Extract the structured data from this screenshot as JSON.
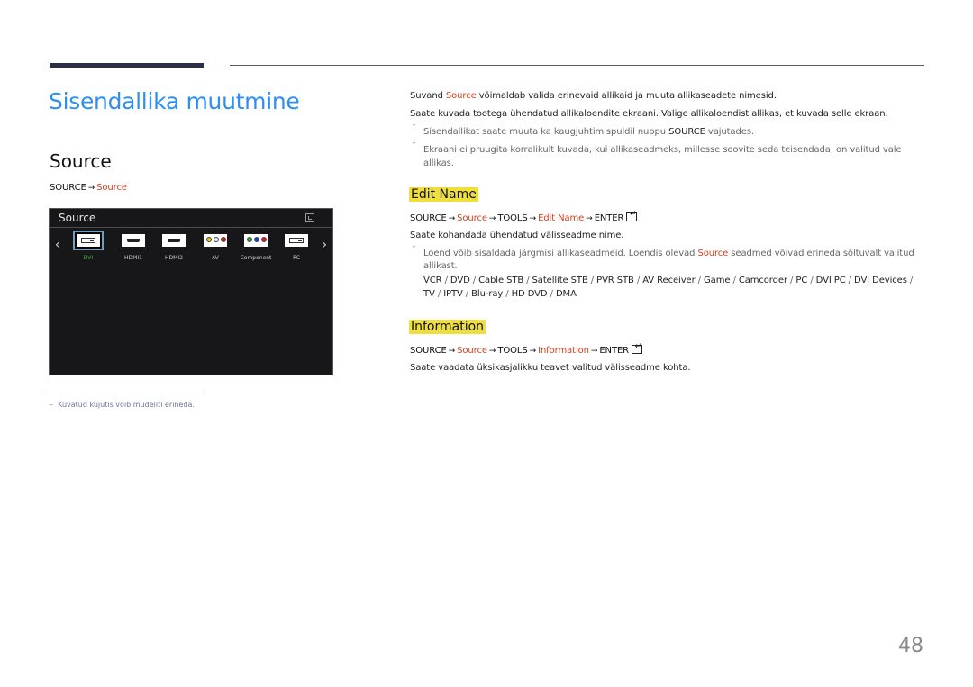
{
  "page": {
    "title": "Sisendallika muutmine",
    "section_title": "Source",
    "path": {
      "root": "SOURCE",
      "arrow": "→",
      "target": "Source"
    },
    "page_number": "48",
    "footnote": "Kuvatud kujutis võib mudeliti erineda."
  },
  "tv_screen": {
    "title": "Source",
    "sources": [
      {
        "label": "DVI",
        "icon": "dvi-port-icon",
        "selected": true
      },
      {
        "label": "HDMI1",
        "icon": "hdmi-port-icon"
      },
      {
        "label": "HDMI2",
        "icon": "hdmi-port-icon"
      },
      {
        "label": "AV",
        "icon": "av-port-icon"
      },
      {
        "label": "Component",
        "icon": "component-port-icon"
      },
      {
        "label": "PC",
        "icon": "pc-port-icon"
      }
    ],
    "colors": {
      "selected_label": "#4fb53a",
      "av": [
        "#e7c318",
        "#f0f0f0",
        "#d42020"
      ],
      "component": [
        "#22a83a",
        "#2040d0",
        "#d42020"
      ]
    }
  },
  "right": {
    "intro1": {
      "pre": "Suvand ",
      "hl": "Source",
      "post": " võimaldab valida erinevaid allikaid ja muuta allikaseadete nimesid."
    },
    "intro2": "Saate kuvada tootega ühendatud allikaloendite ekraani. Valige allikaloendist allikas, et kuvada selle ekraan.",
    "note1": {
      "pre": "Sisendallikat saate muuta ka kaugjuhtimispuldil nuppu ",
      "key": "SOURCE",
      "post": " vajutades."
    },
    "note2_line1": "Ekraani ei pruugita korralikult kuvada, kui allikaseadmeks, millesse soovite seda teisendada, on valitud vale",
    "note2_line2": "allikas.",
    "edit_name": {
      "heading": "Edit Name",
      "path": [
        "SOURCE",
        "Source",
        "TOOLS",
        "Edit Name",
        "ENTER"
      ],
      "desc": "Saate kohandada ühendatud välisseadme nime.",
      "note_pre": "Loend võib sisaldada järgmisi allikaseadmeid. Loendis olevad ",
      "note_hl": "Source",
      "note_post": " seadmed võivad erineda sõltuvalt valitud",
      "note_line2": "allikast.",
      "devices_line1": [
        "VCR",
        "DVD",
        "Cable STB",
        "Satellite STB",
        "PVR STB",
        "AV Receiver",
        "Game",
        "Camcorder",
        "PC",
        "DVI PC",
        "DVI Devices"
      ],
      "devices_line2": [
        "TV",
        "IPTV",
        "Blu-ray",
        "HD DVD",
        "DMA"
      ]
    },
    "information": {
      "heading": "Information",
      "path": [
        "SOURCE",
        "Source",
        "TOOLS",
        "Information",
        "ENTER"
      ],
      "desc": "Saate vaadata üksikasjalikku teavet valitud välisseadme kohta."
    }
  },
  "colors": {
    "title_blue": "#2f8ef2",
    "link_red": "#d1401c",
    "highlight_yellow": "#eedf3d"
  }
}
